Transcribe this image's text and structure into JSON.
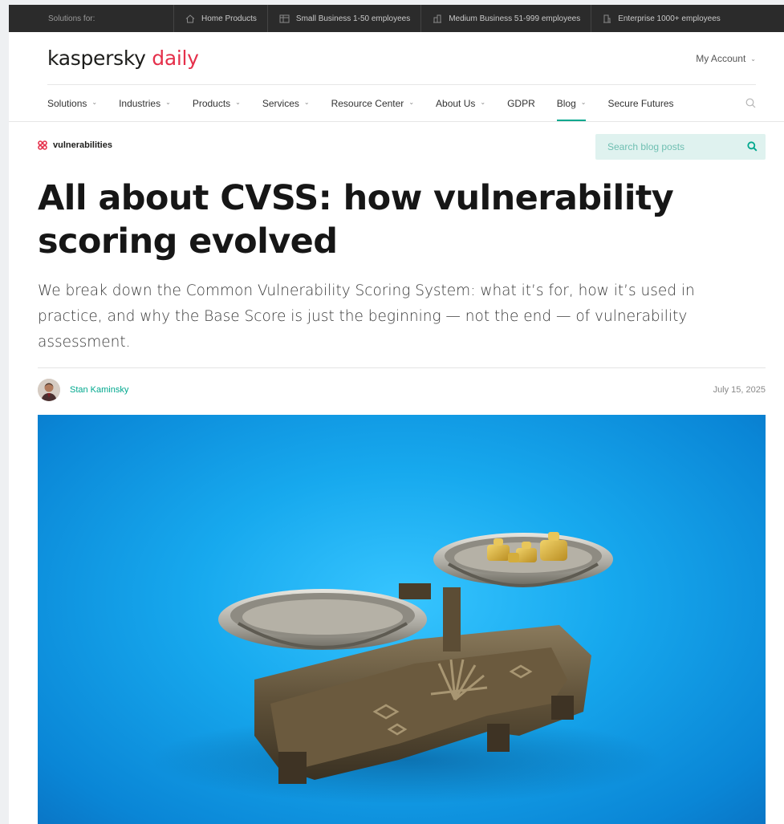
{
  "topbar": {
    "label": "Solutions for:",
    "segments": [
      {
        "label": "Home Products",
        "icon": "house-icon"
      },
      {
        "label": "Small Business 1-50 employees",
        "icon": "office-small-icon"
      },
      {
        "label": "Medium Business 51-999 employees",
        "icon": "office-medium-icon"
      },
      {
        "label": "Enterprise 1000+ employees",
        "icon": "enterprise-icon"
      }
    ]
  },
  "header": {
    "logo_brand": "kaspersky",
    "logo_suffix": "daily",
    "account_label": "My Account"
  },
  "nav": {
    "items": [
      {
        "label": "Solutions",
        "dropdown": true
      },
      {
        "label": "Industries",
        "dropdown": true
      },
      {
        "label": "Products",
        "dropdown": true
      },
      {
        "label": "Services",
        "dropdown": true
      },
      {
        "label": "Resource Center",
        "dropdown": true
      },
      {
        "label": "About Us",
        "dropdown": true
      },
      {
        "label": "GDPR",
        "dropdown": false
      },
      {
        "label": "Blog",
        "dropdown": true,
        "active": true
      },
      {
        "label": "Secure Futures",
        "dropdown": false
      }
    ]
  },
  "article": {
    "tag": "vulnerabilities",
    "search_placeholder": "Search blog posts",
    "title": "All about CVSS: how vulnerability scoring evolved",
    "subtitle": "We break down the Common Vulnerability Scoring System: what it’s for, how it’s used in practice, and why the Base Score is just the beginning — not the end — of vulnerability assessment.",
    "author": "Stan Kaminsky",
    "date": "July 15, 2025"
  },
  "colors": {
    "accent": "#00a88e",
    "brand_red": "#e5304b",
    "topbar": "#2b2b2b",
    "hero_blue": "#17a9ee"
  }
}
